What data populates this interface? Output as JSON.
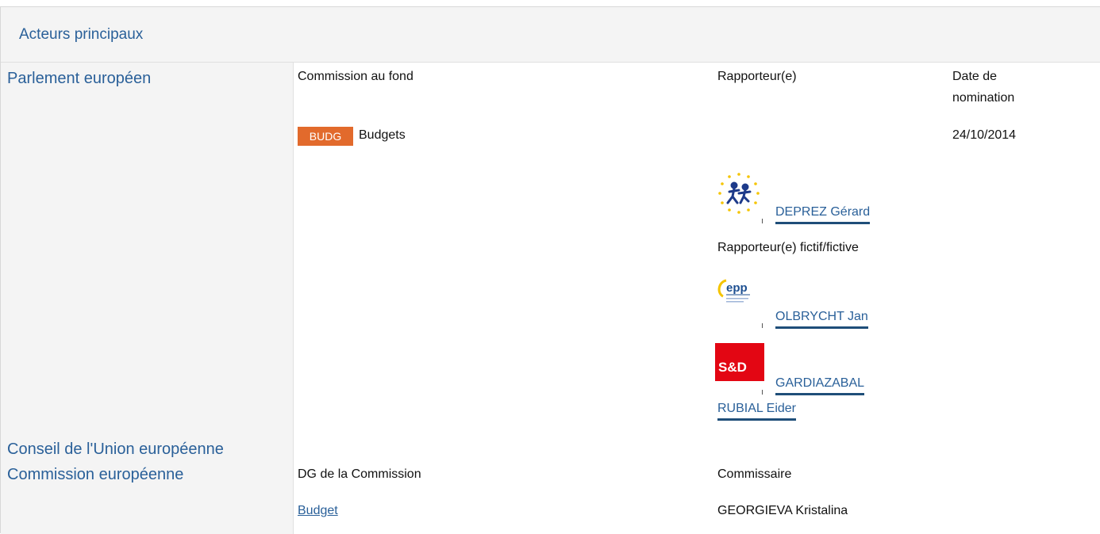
{
  "section": {
    "title": "Acteurs principaux"
  },
  "actors": {
    "parliament": "Parlement européen",
    "council": "Conseil de l'Union européenne",
    "commission": "Commission européenne"
  },
  "parliament": {
    "col_committee": "Commission au fond",
    "col_rapporteur": "Rapporteur(e)",
    "col_date_line1": "Date de",
    "col_date_line2": "nomination",
    "committee_code": "BUDG",
    "committee_name": "Budgets",
    "date": "24/10/2014",
    "rapporteur": {
      "name": "DEPREZ Gérard",
      "group_logo": "alde-logo"
    },
    "shadow_label": "Rapporteur(e) fictif/fictive",
    "shadows": [
      {
        "name": "OLBRYCHT Jan",
        "group_logo": "epp-logo",
        "logo_text": "epp"
      },
      {
        "name_line1": "GARDIAZABAL",
        "name_line2": "RUBIAL Eider",
        "group_logo": "sd-logo",
        "logo_text": "S&D"
      }
    ]
  },
  "commission": {
    "col_dg": "DG de la Commission",
    "col_commissioner": "Commissaire",
    "dg": "Budget",
    "commissioner": "GEORGIEVA Kristalina"
  },
  "colors": {
    "link": "#2a6099",
    "badge": "#e26a2c",
    "sd_red": "#e30613",
    "panel": "#f4f4f4"
  }
}
